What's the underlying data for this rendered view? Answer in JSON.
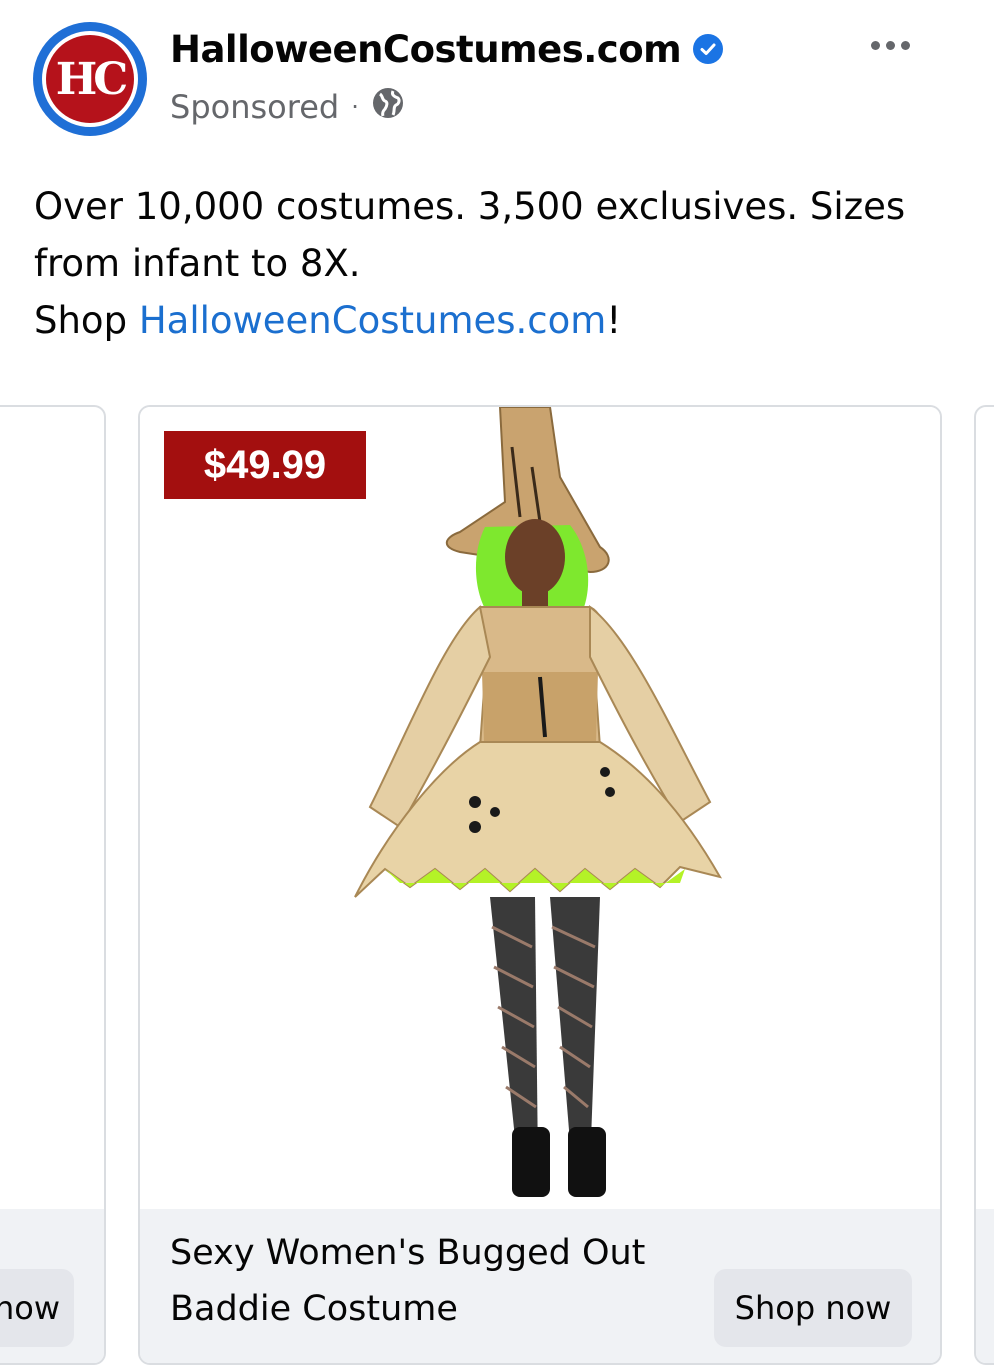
{
  "post": {
    "page_name": "HalloweenCostumes.com",
    "avatar_text": "HC",
    "sponsored_label": "Sponsored",
    "separator": "·",
    "caption_line1": "Over 10,000 costumes. 3,500 exclusives. Sizes from infant to 8X.",
    "caption_shop_prefix": "Shop ",
    "caption_link": "HalloweenCostumes.com",
    "caption_suffix": "!"
  },
  "carousel": {
    "left_card_button_partial": "now",
    "main_card": {
      "price": "$49.99",
      "title": "Sexy Women's Bugged Out Baddie Costume",
      "button": "Shop now"
    }
  },
  "colors": {
    "link": "#1b6fcf",
    "price_tag": "#a30f0f",
    "verified": "#1b74e4",
    "avatar_ring": "#1f6fd6",
    "avatar_core": "#b5121b"
  },
  "icons": {
    "verified": "verified-badge-icon",
    "audience": "globe-icon",
    "menu": "more-options-icon"
  }
}
